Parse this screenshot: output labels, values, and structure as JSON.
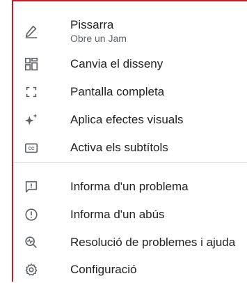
{
  "menu": {
    "items": [
      {
        "icon": "pen-icon",
        "label": "Pissarra",
        "sublabel": "Obre un Jam"
      },
      {
        "icon": "layout-icon",
        "label": "Canvia el disseny"
      },
      {
        "icon": "fullscreen-icon",
        "label": "Pantalla completa"
      },
      {
        "icon": "sparkle-icon",
        "label": "Aplica efectes visuals"
      },
      {
        "icon": "closed-captions-icon",
        "label": "Activa els subtítols"
      },
      {
        "icon": "report-problem-icon",
        "label": "Informa d'un problema"
      },
      {
        "icon": "report-abuse-icon",
        "label": "Informa d'un abús"
      },
      {
        "icon": "troubleshoot-icon",
        "label": "Resolució de problemes i ajuda"
      },
      {
        "icon": "settings-gear-icon",
        "label": "Configuració"
      }
    ]
  },
  "colors": {
    "border_accent": "#c0202a",
    "text": "#202124",
    "icon": "#5f6368",
    "divider": "#dadce0"
  }
}
